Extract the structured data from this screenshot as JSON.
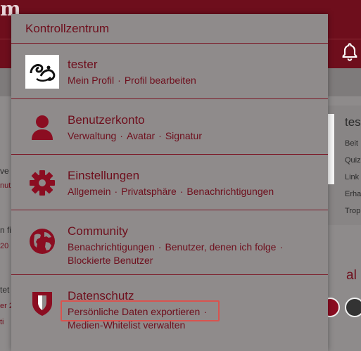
{
  "background": {
    "logo_fragment": "m",
    "left_fragments": [
      "ve",
      "nut",
      "n fi",
      "20",
      "tet",
      "er 2",
      "ti"
    ],
    "right_card": {
      "name": "tes",
      "items": [
        "Beit",
        "Quiz",
        "Link",
        "Erha",
        "Trop"
      ]
    },
    "right_section_letter": "al"
  },
  "panel": {
    "title": "Kontrollzentrum",
    "rows": [
      {
        "title": "tester",
        "links": [
          "Mein Profil",
          "Profil bearbeiten"
        ]
      },
      {
        "title": "Benutzerkonto",
        "links": [
          "Verwaltung",
          "Avatar",
          "Signatur"
        ]
      },
      {
        "title": "Einstellungen",
        "links": [
          "Allgemein",
          "Privatsphäre",
          "Benachrichtigungen"
        ]
      },
      {
        "title": "Community",
        "links": [
          "Benachrichtigungen",
          "Benutzer, denen ich folge",
          "Blockierte Benutzer"
        ]
      },
      {
        "title": "Datenschutz",
        "links": [
          "Persönliche Daten exportieren",
          "Medien-Whitelist verwalten"
        ]
      }
    ],
    "separator": "·"
  },
  "colors": {
    "brand": "#6e0e1c",
    "overlay": "#8f8b8b",
    "highlight": "#d9534f"
  }
}
